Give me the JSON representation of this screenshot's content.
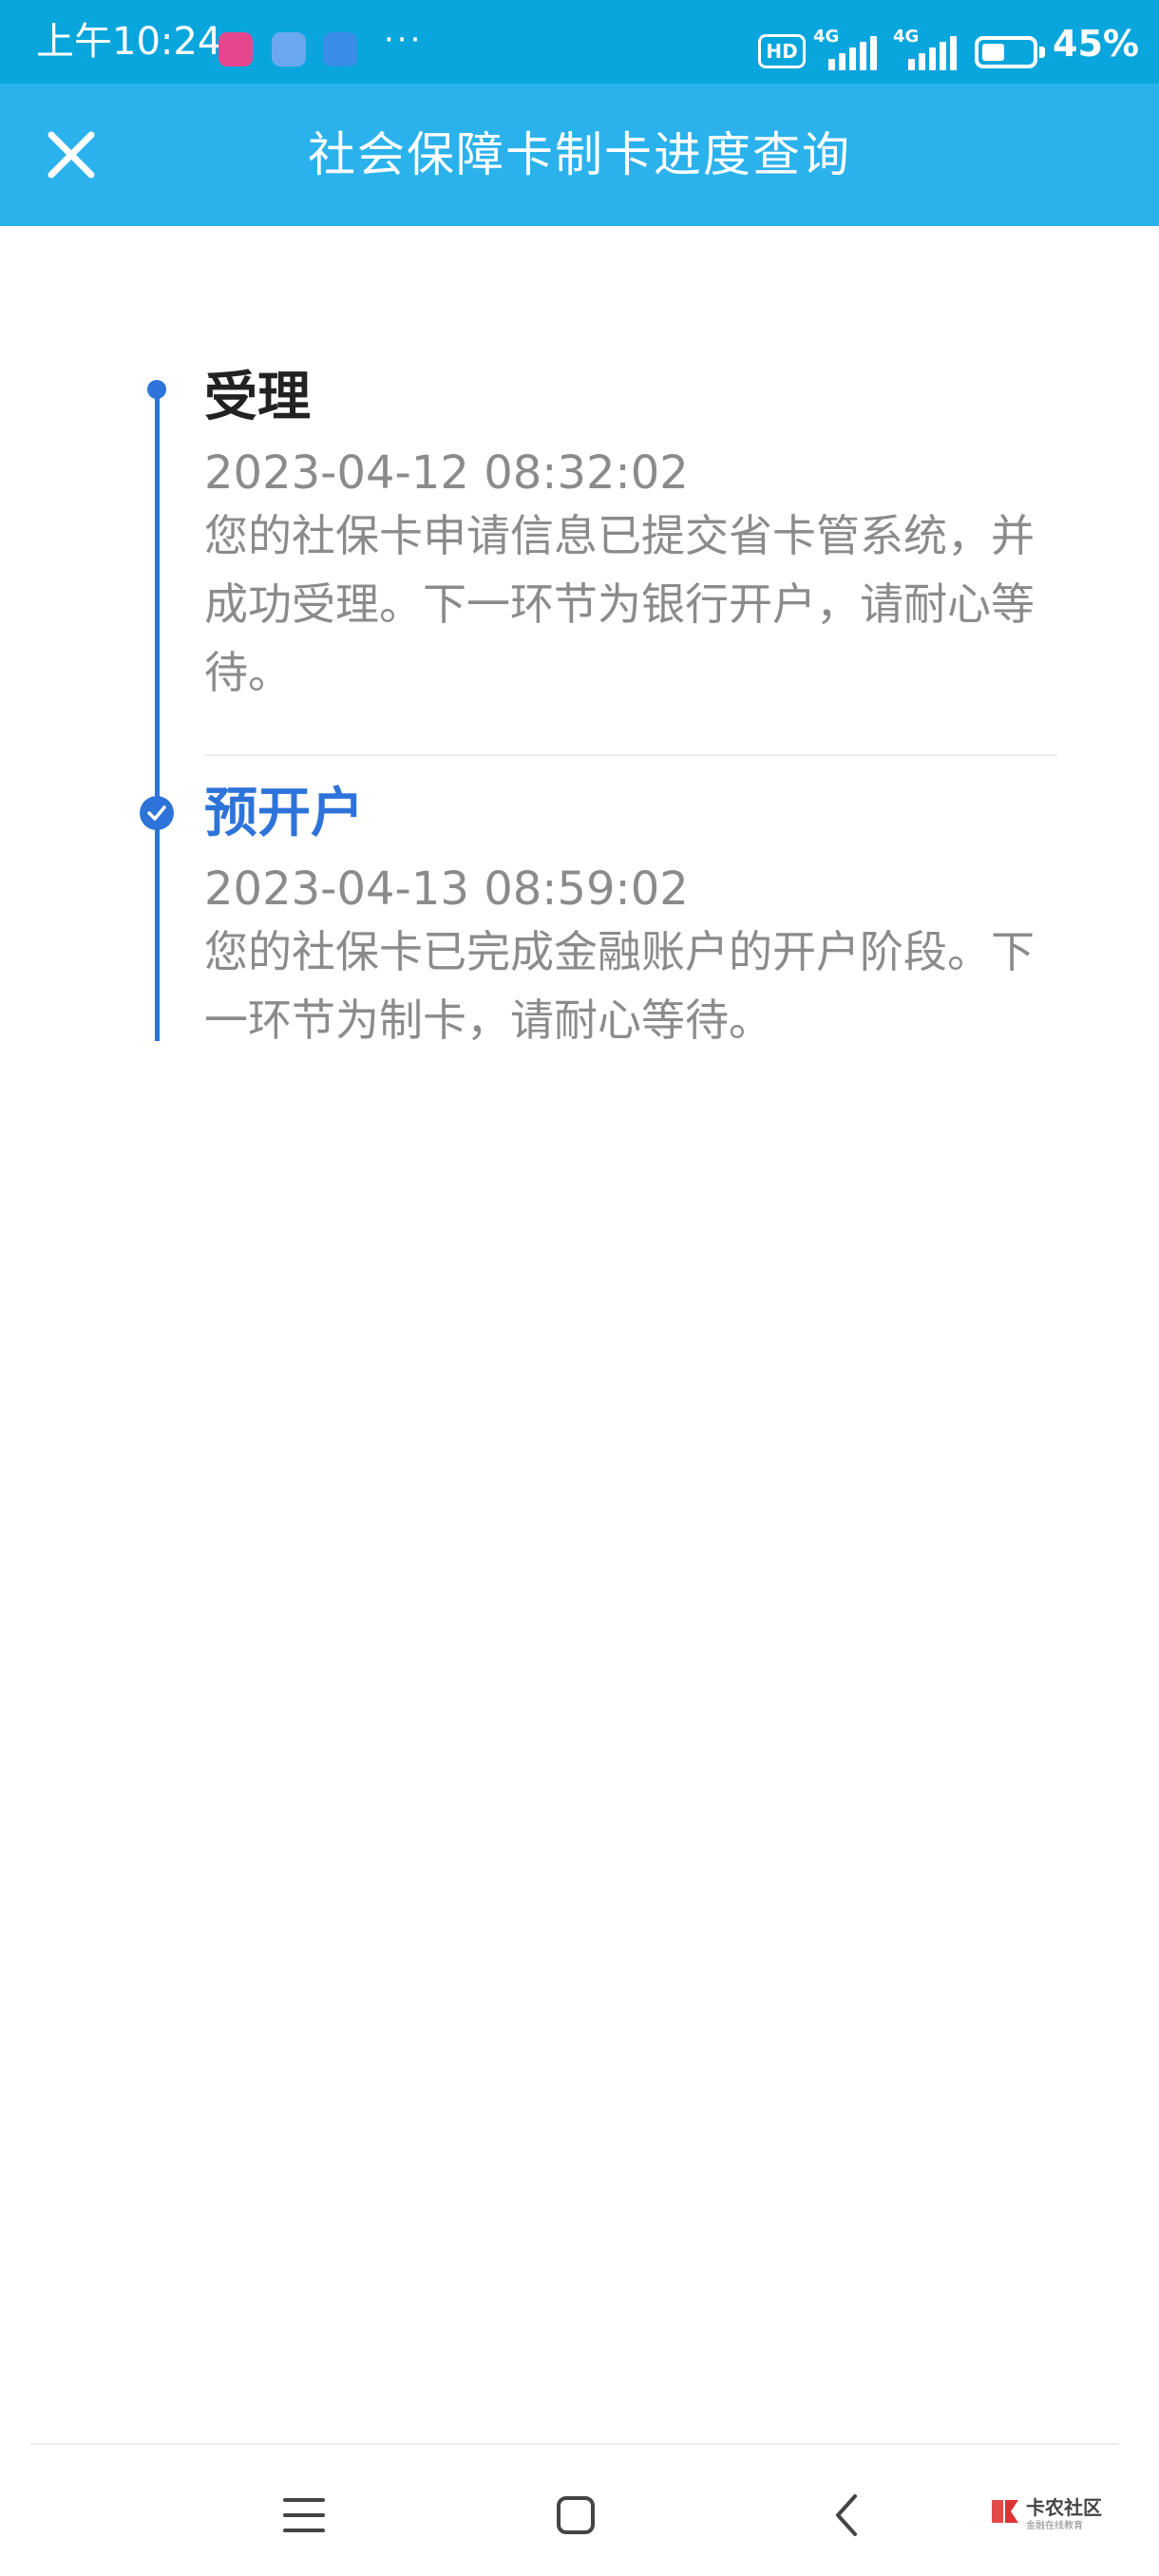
{
  "status_bar": {
    "time": "上午10:24",
    "hd": "HD",
    "network1": "4G",
    "network2": "4G",
    "battery_percent": "45%",
    "battery_level": 0.45,
    "more": "···",
    "icons": [
      "app-icon-pink",
      "app-icon-blue",
      "app-icon-alipay"
    ]
  },
  "header": {
    "title": "社会保障卡制卡进度查询",
    "close_icon": "close-icon"
  },
  "timeline": {
    "steps": [
      {
        "title": "受理",
        "time": "2023-04-12 08:32:02",
        "description": "您的社保卡申请信息已提交省卡管系统，并成功受理。下一环节为银行开户，请耐心等待。",
        "active": false
      },
      {
        "title": "预开户",
        "time": "2023-04-13 08:59:02",
        "description": "您的社保卡已完成金融账户的开户阶段。下一环节为制卡，请耐心等待。",
        "active": true
      }
    ]
  },
  "nav": {
    "menu_icon": "menu-icon",
    "home_icon": "home-icon",
    "back_icon": "back-icon"
  },
  "watermark": {
    "text": "卡农社区",
    "subtext": "金融在线教育"
  },
  "colors": {
    "status_bar": "#08a6dc",
    "header": "#2bb2ec",
    "accent": "#2d73d9",
    "text_dark": "#222222",
    "text_gray": "#8b8b8b"
  }
}
